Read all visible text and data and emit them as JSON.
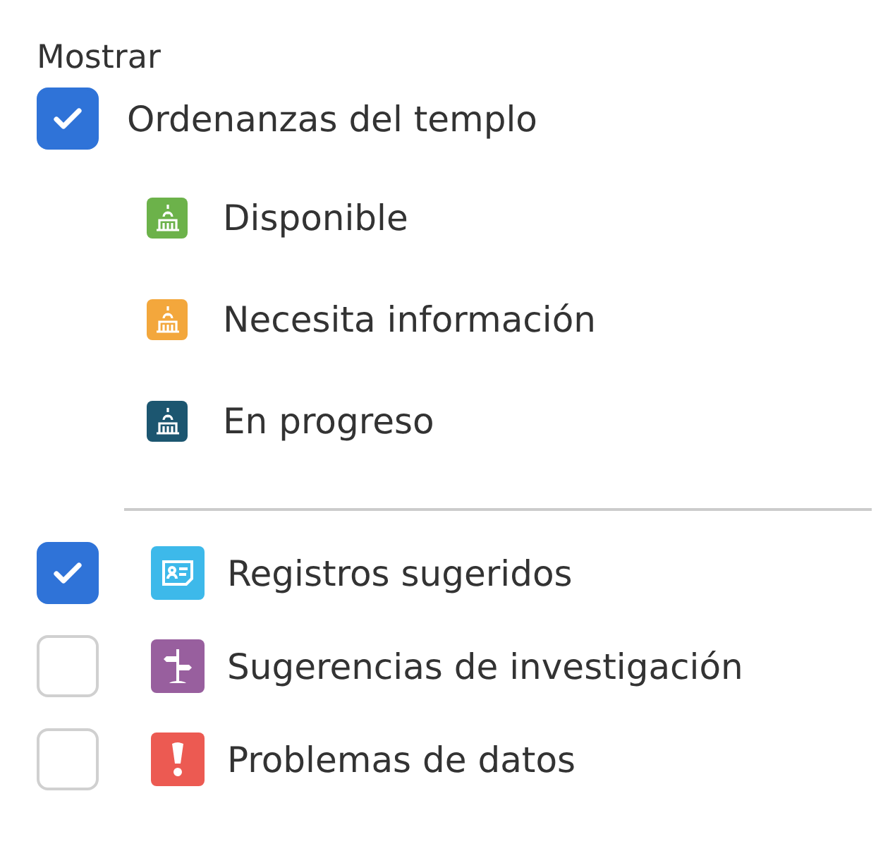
{
  "heading": "Mostrar",
  "temple": {
    "label": "Ordenanzas del templo",
    "checked": true,
    "legend": [
      {
        "label": "Disponible",
        "color": "#6cb24a"
      },
      {
        "label": "Necesita información",
        "color": "#f3a73c"
      },
      {
        "label": "En progreso",
        "color": "#1c5670"
      }
    ]
  },
  "options": [
    {
      "kind": "record",
      "label": "Registros sugeridos",
      "checked": true,
      "color": "#3db9ea"
    },
    {
      "kind": "signpost",
      "label": "Sugerencias de investigación",
      "checked": false,
      "color": "#985f9e"
    },
    {
      "kind": "alert",
      "label": "Problemas de datos",
      "checked": false,
      "color": "#ec5a52"
    }
  ]
}
